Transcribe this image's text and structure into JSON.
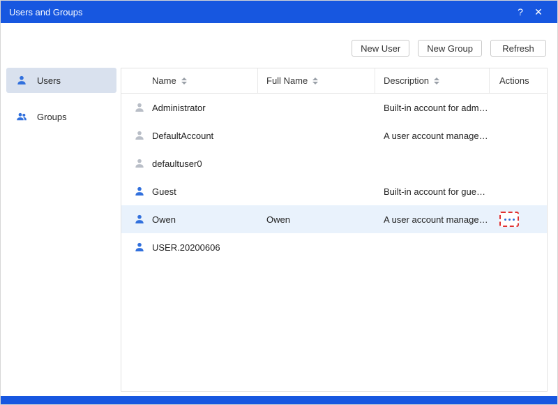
{
  "window": {
    "title": "Users and Groups",
    "help_icon": "?",
    "close_icon": "✕"
  },
  "toolbar": {
    "new_user_label": "New User",
    "new_group_label": "New Group",
    "refresh_label": "Refresh"
  },
  "sidebar": {
    "items": [
      {
        "label": "Users",
        "icon": "user-icon",
        "selected": true
      },
      {
        "label": "Groups",
        "icon": "users-group-icon",
        "selected": false
      }
    ]
  },
  "table": {
    "headers": [
      {
        "label": "Name",
        "sortable": true
      },
      {
        "label": "Full Name",
        "sortable": true
      },
      {
        "label": "Description",
        "sortable": true
      },
      {
        "label": "Actions",
        "sortable": false
      }
    ],
    "rows": [
      {
        "name": "Administrator",
        "full_name": "",
        "description": "Built-in account for admin...",
        "icon": "user-icon",
        "icon_variant": "gray",
        "selected": false
      },
      {
        "name": "DefaultAccount",
        "full_name": "",
        "description": "A user account managed...",
        "icon": "user-icon",
        "icon_variant": "gray",
        "selected": false
      },
      {
        "name": "defaultuser0",
        "full_name": "",
        "description": "",
        "icon": "user-icon",
        "icon_variant": "gray",
        "selected": false
      },
      {
        "name": "Guest",
        "full_name": "",
        "description": "Built-in account for guest...",
        "icon": "user-icon",
        "icon_variant": "blue",
        "selected": false
      },
      {
        "name": "Owen",
        "full_name": "Owen",
        "description": "A user account managed...",
        "icon": "user-icon",
        "icon_variant": "blue",
        "selected": true,
        "action_icon": "ellipsis-menu-icon",
        "action_highlight": "red-dashed"
      },
      {
        "name": "USER.20200606",
        "full_name": "",
        "description": "",
        "icon": "user-icon",
        "icon_variant": "blue",
        "selected": false
      }
    ]
  },
  "colors": {
    "titlebar_blue": "#1757e0",
    "accent_blue": "#3170dd",
    "gray_icon": "#b9bec7",
    "selected_row_bg": "#e9f2fc",
    "red_highlight": "#e03030"
  }
}
